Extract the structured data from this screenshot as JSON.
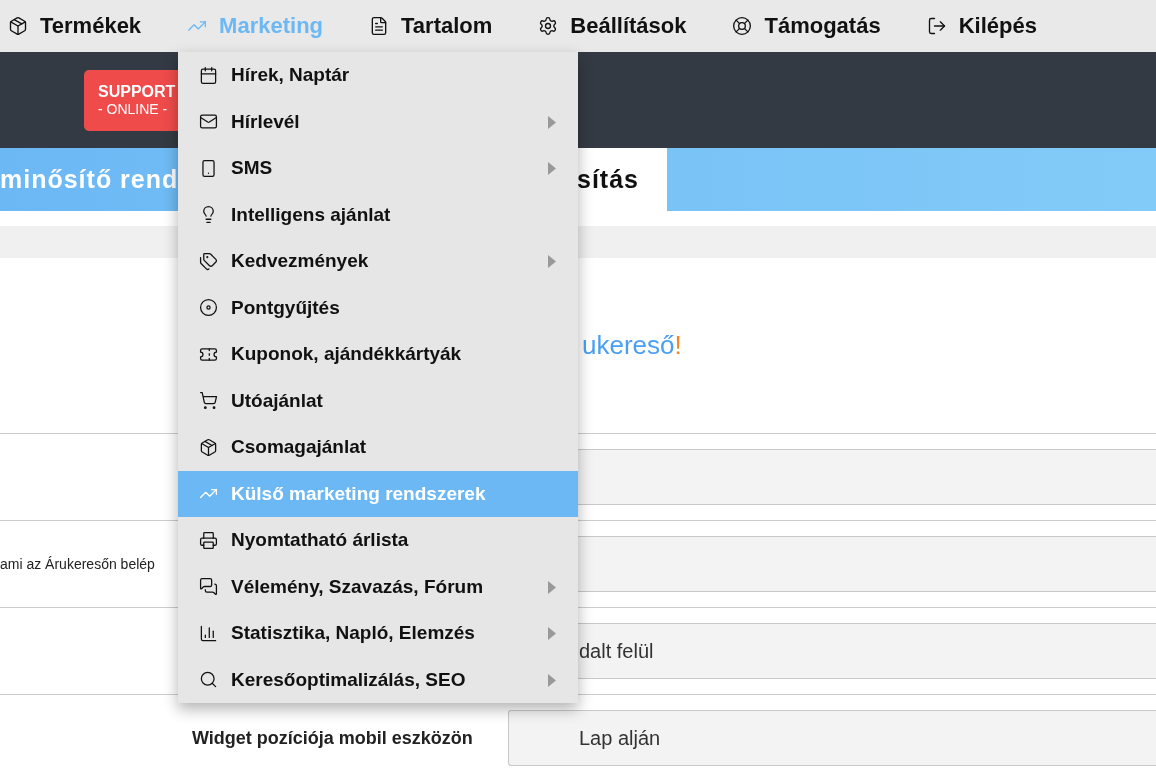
{
  "nav": [
    {
      "label": "Termékek",
      "selected": false
    },
    {
      "label": "Marketing",
      "selected": true
    },
    {
      "label": "Tartalom",
      "selected": false
    },
    {
      "label": "Beállítások",
      "selected": false
    },
    {
      "label": "Támogatás",
      "selected": false
    },
    {
      "label": "Kilépés",
      "selected": false
    }
  ],
  "support_badge": {
    "title": "SUPPORT",
    "subtitle": "- ONLINE -"
  },
  "tabs": [
    {
      "label": "minősítő rend",
      "selected": false
    },
    {
      "label": "sítás",
      "selected": true
    }
  ],
  "logo": {
    "text": "ukereső",
    "mark": "!"
  },
  "form_rows": [
    {},
    {
      "label": "ami az Árukeresőn belép"
    },
    {
      "value": "dalt felül"
    },
    {
      "label": "Widget pozíciója mobil eszközön",
      "value": "Lap alján"
    }
  ],
  "menu": [
    {
      "label": "Hírek, Naptár",
      "submenu": false,
      "selected": false
    },
    {
      "label": "Hírlevél",
      "submenu": true,
      "selected": false
    },
    {
      "label": "SMS",
      "submenu": true,
      "selected": false
    },
    {
      "label": "Intelligens ajánlat",
      "submenu": false,
      "selected": false
    },
    {
      "label": "Kedvezmények",
      "submenu": true,
      "selected": false
    },
    {
      "label": "Pontgyűjtés",
      "submenu": false,
      "selected": false
    },
    {
      "label": "Kuponok, ajándékkártyák",
      "submenu": false,
      "selected": false
    },
    {
      "label": "Utóajánlat",
      "submenu": false,
      "selected": false
    },
    {
      "label": "Csomagajánlat",
      "submenu": false,
      "selected": false
    },
    {
      "label": "Külső marketing rendszerek",
      "submenu": false,
      "selected": true
    },
    {
      "label": "Nyomtatható árlista",
      "submenu": false,
      "selected": false
    },
    {
      "label": "Vélemény, Szavazás, Fórum",
      "submenu": true,
      "selected": false
    },
    {
      "label": "Statisztika, Napló, Elemzés",
      "submenu": true,
      "selected": false
    },
    {
      "label": "Keresőoptimalizálás, SEO",
      "submenu": true,
      "selected": false
    }
  ]
}
